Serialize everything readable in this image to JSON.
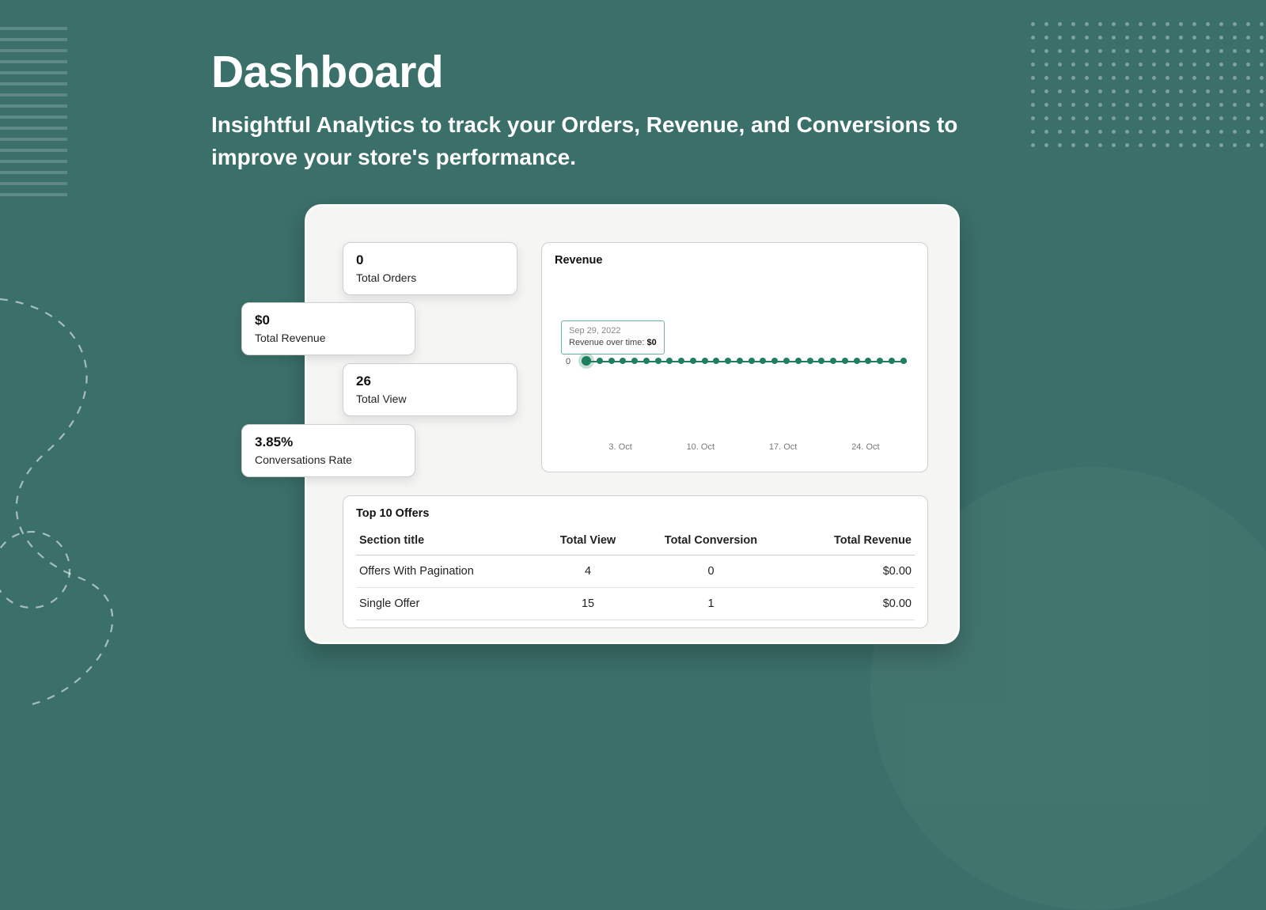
{
  "heading": {
    "title": "Dashboard",
    "subtitle": "Insightful Analytics to track your Orders, Revenue, and Conversions to improve your store's performance."
  },
  "stats": {
    "orders": {
      "value": "0",
      "label": "Total Orders"
    },
    "revenue": {
      "value": "$0",
      "label": "Total Revenue"
    },
    "views": {
      "value": "26",
      "label": "Total View"
    },
    "conv": {
      "value": "3.85%",
      "label": "Conversations Rate"
    }
  },
  "chart": {
    "title": "Revenue",
    "y_zero": "0",
    "tooltip": {
      "date": "Sep 29, 2022",
      "label": "Revenue over time:",
      "value": "$0"
    },
    "x_ticks": [
      "3. Oct",
      "10. Oct",
      "17. Oct",
      "24. Oct"
    ]
  },
  "offers": {
    "title": "Top 10 Offers",
    "headers": {
      "section": "Section title",
      "views": "Total View",
      "conv": "Total Conversion",
      "rev": "Total Revenue"
    },
    "rows": [
      {
        "section": "Offers With Pagination",
        "views": "4",
        "conv": "0",
        "rev": "$0.00"
      },
      {
        "section": "Single Offer",
        "views": "15",
        "conv": "1",
        "rev": "$0.00"
      }
    ]
  },
  "chart_data": {
    "type": "line",
    "title": "Revenue",
    "ylabel": "Revenue over time",
    "ylim": [
      0,
      0
    ],
    "x": [
      "Sep 29",
      "Sep 30",
      "Oct 1",
      "Oct 2",
      "Oct 3",
      "Oct 4",
      "Oct 5",
      "Oct 6",
      "Oct 7",
      "Oct 8",
      "Oct 9",
      "Oct 10",
      "Oct 11",
      "Oct 12",
      "Oct 13",
      "Oct 14",
      "Oct 15",
      "Oct 16",
      "Oct 17",
      "Oct 18",
      "Oct 19",
      "Oct 20",
      "Oct 21",
      "Oct 22",
      "Oct 23",
      "Oct 24",
      "Oct 25",
      "Oct 26"
    ],
    "series": [
      {
        "name": "Revenue over time",
        "values": [
          0,
          0,
          0,
          0,
          0,
          0,
          0,
          0,
          0,
          0,
          0,
          0,
          0,
          0,
          0,
          0,
          0,
          0,
          0,
          0,
          0,
          0,
          0,
          0,
          0,
          0,
          0,
          0
        ]
      }
    ],
    "x_tick_labels": [
      "3. Oct",
      "10. Oct",
      "17. Oct",
      "24. Oct"
    ],
    "highlight": {
      "x": "Sep 29",
      "value": 0
    }
  }
}
